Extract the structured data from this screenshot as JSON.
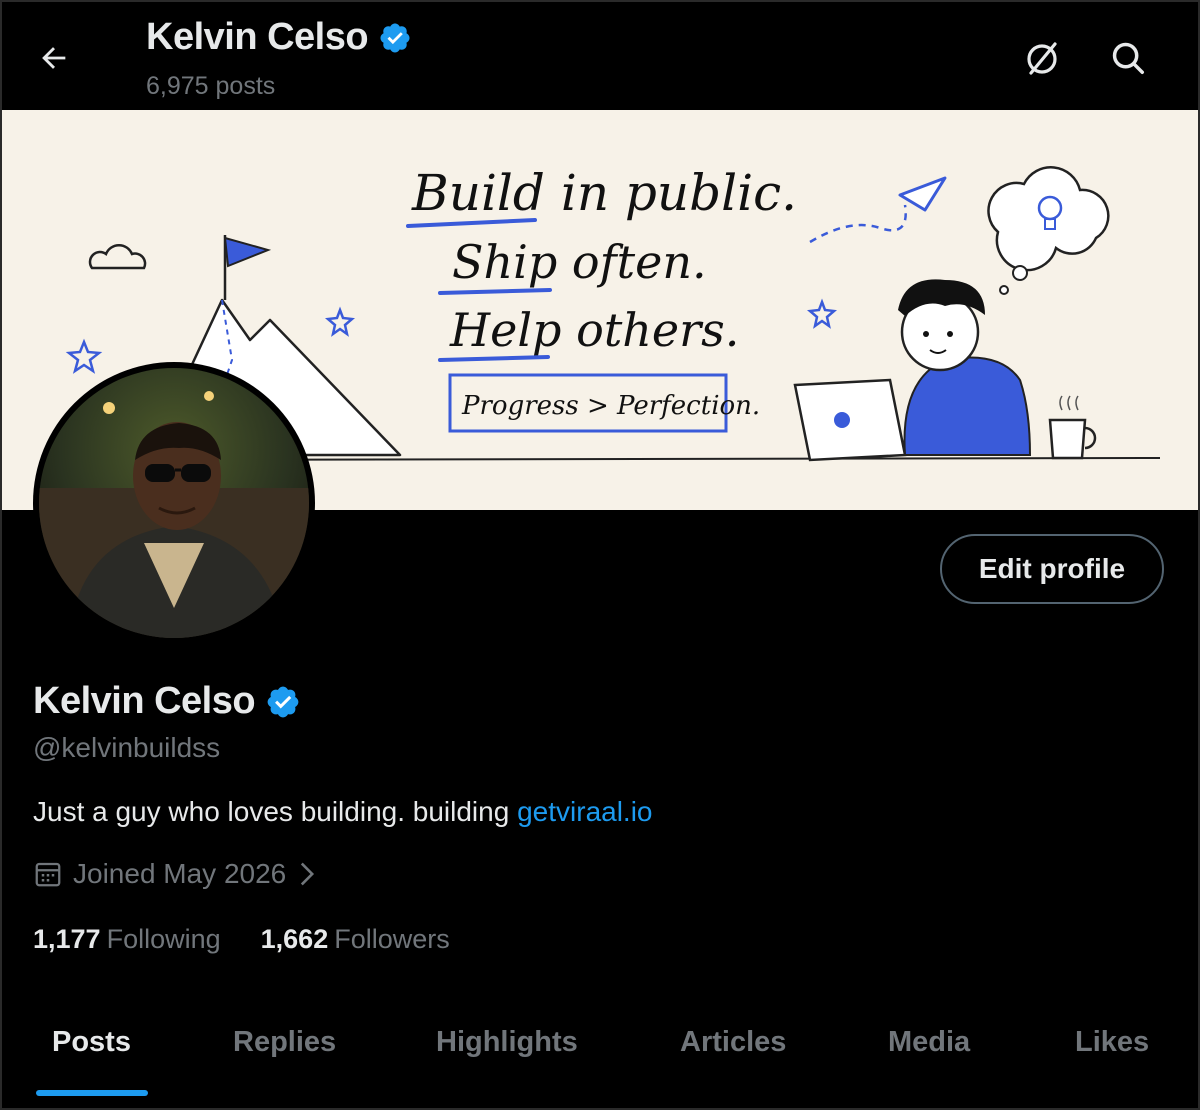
{
  "header": {
    "title": "Kelvin Celso",
    "post_count": "6,975 posts",
    "back_icon": "arrow-left-icon",
    "icons": [
      "grok-icon",
      "search-icon"
    ]
  },
  "banner": {
    "line1": "Build in public.",
    "line2": "Ship often.",
    "line3": "Help others.",
    "tagline": "Progress > Perfection."
  },
  "profile": {
    "name": "Kelvin Celso",
    "handle": "@kelvinbuildss",
    "bio_text": "Just a guy who loves building. building ",
    "bio_link": "getviraal.io",
    "joined": "Joined May 2026",
    "edit_button": "Edit profile",
    "verified_color": "#1d9bf0"
  },
  "stats": {
    "following_count": "1,177",
    "following_label": "Following",
    "followers_count": "1,662",
    "followers_label": "Followers"
  },
  "tabs": [
    "Posts",
    "Replies",
    "Highlights",
    "Articles",
    "Media",
    "Likes"
  ],
  "colors": {
    "accent": "#1d9bf0",
    "muted": "#71767b",
    "text": "#e7e9ea",
    "bg": "#000000",
    "banner_bg": "#f7f2e8",
    "banner_blue": "#3a5bd9"
  }
}
